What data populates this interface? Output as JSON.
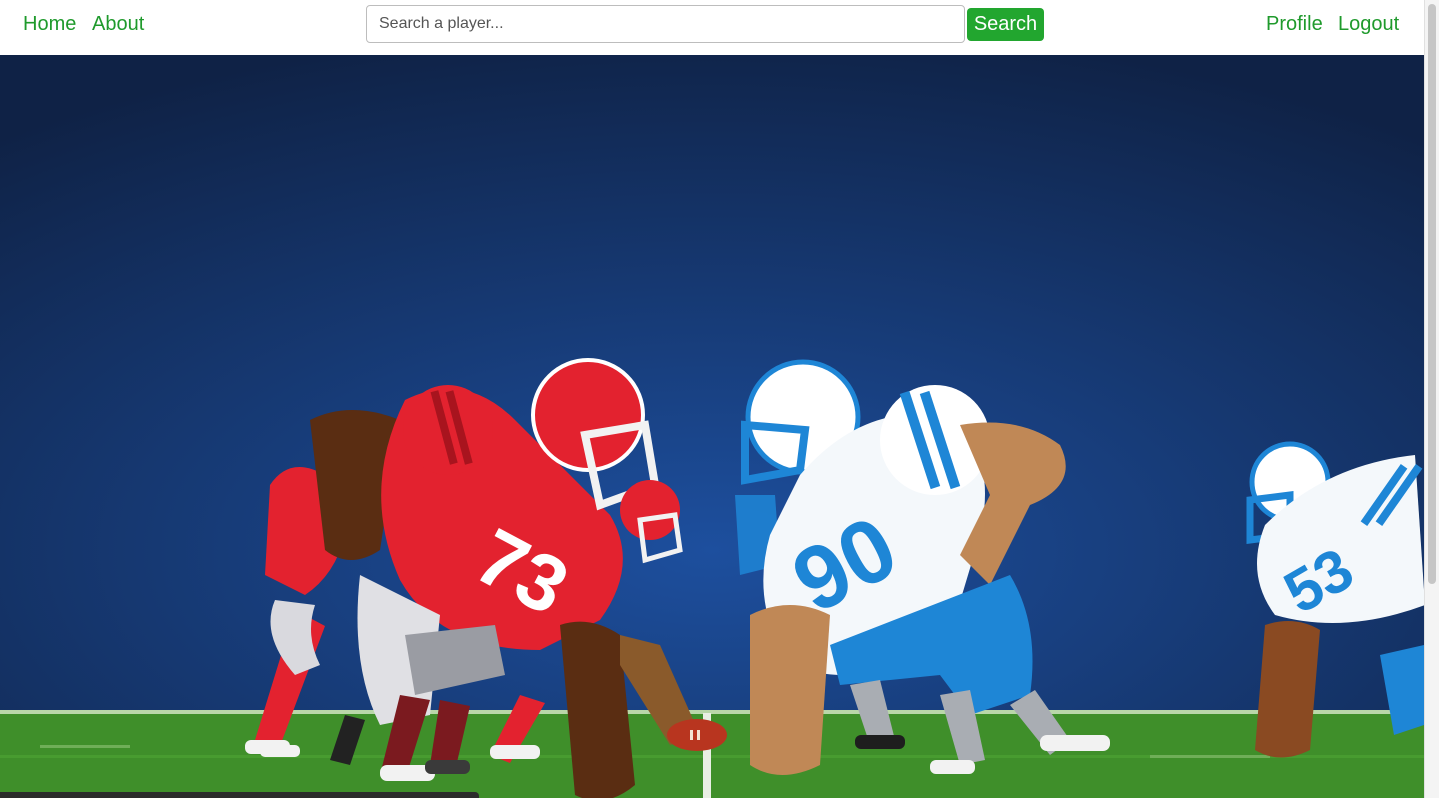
{
  "nav": {
    "home_label": "Home",
    "about_label": "About",
    "profile_label": "Profile",
    "logout_label": "Logout"
  },
  "search": {
    "placeholder": "Search a player...",
    "value": "",
    "button_label": "Search"
  },
  "hero": {
    "jersey_numbers": [
      "73",
      "90",
      "53"
    ]
  },
  "colors": {
    "link_green": "#1f9a2c",
    "button_green": "#22a62f",
    "sky_dark": "#0f2246",
    "sky_light": "#1d4f9e",
    "field_green": "#3f8f2a",
    "team_red": "#e3222f",
    "team_blue": "#1e86d6"
  }
}
